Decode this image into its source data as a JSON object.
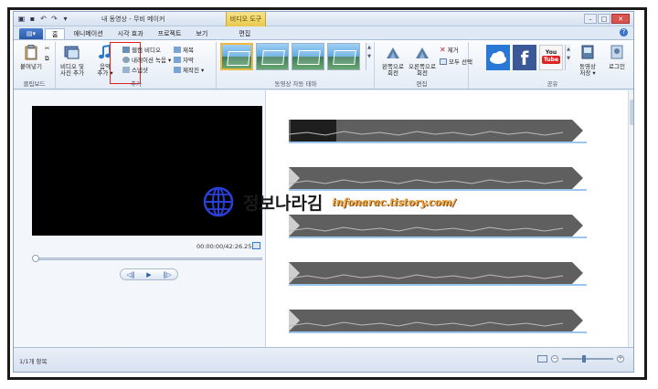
{
  "window": {
    "title": "내 동영상 - 무비 메이커",
    "context_tab": "비디오 도구"
  },
  "tabs": [
    "홈",
    "애니메이션",
    "시각 효과",
    "프로젝트",
    "보기",
    "편집"
  ],
  "ribbon": {
    "clipboard": {
      "label": "클립보드",
      "paste": "붙여넣기"
    },
    "add": {
      "label": "추가",
      "video_photo_add": [
        "비디오 및",
        "사진 추가"
      ],
      "music_add": [
        "음악",
        "추가 ▾"
      ],
      "webcam": "웹캠 비디오",
      "narration": "내레이션 녹음 ▾",
      "snapshot": "스냅샷",
      "title": "제목",
      "caption": "자막",
      "credits": "제작진 ▾"
    },
    "themes": {
      "label": "동영상 자동 테마"
    },
    "edit": {
      "label": "편집",
      "rotate_left": [
        "왼쪽으로",
        "회전"
      ],
      "rotate_right": [
        "오른쪽으로",
        "회전"
      ],
      "remove": "제거",
      "select_all": "모두 선택"
    },
    "share": {
      "label": "공유",
      "save_movie": [
        "동영상",
        "저장 ▾"
      ],
      "sign_in": "로그인"
    }
  },
  "player": {
    "timecode": "00:00:00/42:26.25"
  },
  "status": {
    "items_count": "1/1개 항목"
  },
  "watermark": {
    "korean": "정보나라김",
    "url": "infonarac.tistory.com/"
  },
  "colors": {
    "accent_blue": "#2a5aa9",
    "highlight_red": "#e02020",
    "watermark_orange": "#f2a23a"
  }
}
